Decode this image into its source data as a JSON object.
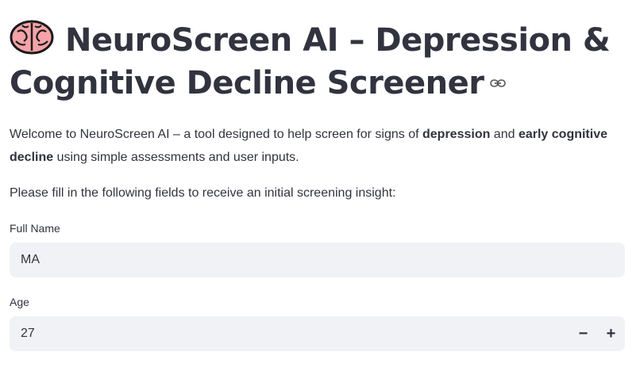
{
  "header": {
    "title": "NeuroScreen AI – Depression & Cognitive Decline Screener",
    "title_icon": "brain-icon",
    "anchor_icon": "link-icon"
  },
  "intro": {
    "part1": "Welcome to NeuroScreen AI – a tool designed to help screen for signs of ",
    "bold1": "depression",
    "part2": " and ",
    "bold2": "early cognitive decline",
    "part3": " using simple assessments and user inputs."
  },
  "instruction": "Please fill in the following fields to receive an initial screening insight:",
  "form": {
    "full_name": {
      "label": "Full Name",
      "value": "MA"
    },
    "age": {
      "label": "Age",
      "value": "27",
      "decrement_label": "−",
      "increment_label": "+"
    }
  },
  "colors": {
    "text": "#31333f",
    "input_bg": "#f0f2f6",
    "brain": "#f4a3a8"
  }
}
